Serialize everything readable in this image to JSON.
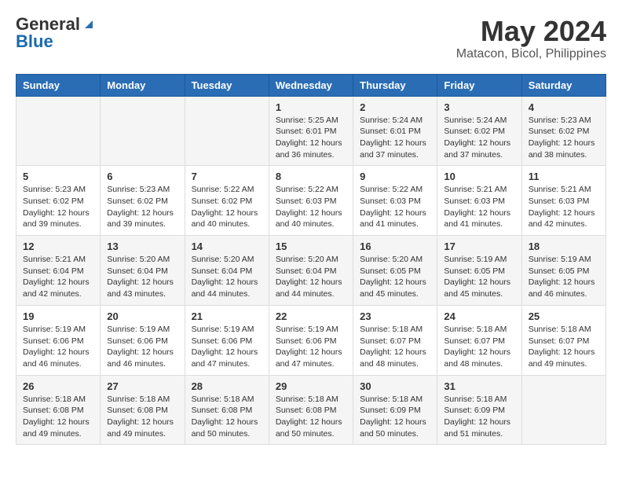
{
  "header": {
    "logo_general": "General",
    "logo_blue": "Blue",
    "month": "May 2024",
    "location": "Matacon, Bicol, Philippines"
  },
  "weekdays": [
    "Sunday",
    "Monday",
    "Tuesday",
    "Wednesday",
    "Thursday",
    "Friday",
    "Saturday"
  ],
  "weeks": [
    [
      {
        "day": "",
        "info": ""
      },
      {
        "day": "",
        "info": ""
      },
      {
        "day": "",
        "info": ""
      },
      {
        "day": "1",
        "info": "Sunrise: 5:25 AM\nSunset: 6:01 PM\nDaylight: 12 hours and 36 minutes."
      },
      {
        "day": "2",
        "info": "Sunrise: 5:24 AM\nSunset: 6:01 PM\nDaylight: 12 hours and 37 minutes."
      },
      {
        "day": "3",
        "info": "Sunrise: 5:24 AM\nSunset: 6:02 PM\nDaylight: 12 hours and 37 minutes."
      },
      {
        "day": "4",
        "info": "Sunrise: 5:23 AM\nSunset: 6:02 PM\nDaylight: 12 hours and 38 minutes."
      }
    ],
    [
      {
        "day": "5",
        "info": "Sunrise: 5:23 AM\nSunset: 6:02 PM\nDaylight: 12 hours and 39 minutes."
      },
      {
        "day": "6",
        "info": "Sunrise: 5:23 AM\nSunset: 6:02 PM\nDaylight: 12 hours and 39 minutes."
      },
      {
        "day": "7",
        "info": "Sunrise: 5:22 AM\nSunset: 6:02 PM\nDaylight: 12 hours and 40 minutes."
      },
      {
        "day": "8",
        "info": "Sunrise: 5:22 AM\nSunset: 6:03 PM\nDaylight: 12 hours and 40 minutes."
      },
      {
        "day": "9",
        "info": "Sunrise: 5:22 AM\nSunset: 6:03 PM\nDaylight: 12 hours and 41 minutes."
      },
      {
        "day": "10",
        "info": "Sunrise: 5:21 AM\nSunset: 6:03 PM\nDaylight: 12 hours and 41 minutes."
      },
      {
        "day": "11",
        "info": "Sunrise: 5:21 AM\nSunset: 6:03 PM\nDaylight: 12 hours and 42 minutes."
      }
    ],
    [
      {
        "day": "12",
        "info": "Sunrise: 5:21 AM\nSunset: 6:04 PM\nDaylight: 12 hours and 42 minutes."
      },
      {
        "day": "13",
        "info": "Sunrise: 5:20 AM\nSunset: 6:04 PM\nDaylight: 12 hours and 43 minutes."
      },
      {
        "day": "14",
        "info": "Sunrise: 5:20 AM\nSunset: 6:04 PM\nDaylight: 12 hours and 44 minutes."
      },
      {
        "day": "15",
        "info": "Sunrise: 5:20 AM\nSunset: 6:04 PM\nDaylight: 12 hours and 44 minutes."
      },
      {
        "day": "16",
        "info": "Sunrise: 5:20 AM\nSunset: 6:05 PM\nDaylight: 12 hours and 45 minutes."
      },
      {
        "day": "17",
        "info": "Sunrise: 5:19 AM\nSunset: 6:05 PM\nDaylight: 12 hours and 45 minutes."
      },
      {
        "day": "18",
        "info": "Sunrise: 5:19 AM\nSunset: 6:05 PM\nDaylight: 12 hours and 46 minutes."
      }
    ],
    [
      {
        "day": "19",
        "info": "Sunrise: 5:19 AM\nSunset: 6:06 PM\nDaylight: 12 hours and 46 minutes."
      },
      {
        "day": "20",
        "info": "Sunrise: 5:19 AM\nSunset: 6:06 PM\nDaylight: 12 hours and 46 minutes."
      },
      {
        "day": "21",
        "info": "Sunrise: 5:19 AM\nSunset: 6:06 PM\nDaylight: 12 hours and 47 minutes."
      },
      {
        "day": "22",
        "info": "Sunrise: 5:19 AM\nSunset: 6:06 PM\nDaylight: 12 hours and 47 minutes."
      },
      {
        "day": "23",
        "info": "Sunrise: 5:18 AM\nSunset: 6:07 PM\nDaylight: 12 hours and 48 minutes."
      },
      {
        "day": "24",
        "info": "Sunrise: 5:18 AM\nSunset: 6:07 PM\nDaylight: 12 hours and 48 minutes."
      },
      {
        "day": "25",
        "info": "Sunrise: 5:18 AM\nSunset: 6:07 PM\nDaylight: 12 hours and 49 minutes."
      }
    ],
    [
      {
        "day": "26",
        "info": "Sunrise: 5:18 AM\nSunset: 6:08 PM\nDaylight: 12 hours and 49 minutes."
      },
      {
        "day": "27",
        "info": "Sunrise: 5:18 AM\nSunset: 6:08 PM\nDaylight: 12 hours and 49 minutes."
      },
      {
        "day": "28",
        "info": "Sunrise: 5:18 AM\nSunset: 6:08 PM\nDaylight: 12 hours and 50 minutes."
      },
      {
        "day": "29",
        "info": "Sunrise: 5:18 AM\nSunset: 6:08 PM\nDaylight: 12 hours and 50 minutes."
      },
      {
        "day": "30",
        "info": "Sunrise: 5:18 AM\nSunset: 6:09 PM\nDaylight: 12 hours and 50 minutes."
      },
      {
        "day": "31",
        "info": "Sunrise: 5:18 AM\nSunset: 6:09 PM\nDaylight: 12 hours and 51 minutes."
      },
      {
        "day": "",
        "info": ""
      }
    ]
  ]
}
